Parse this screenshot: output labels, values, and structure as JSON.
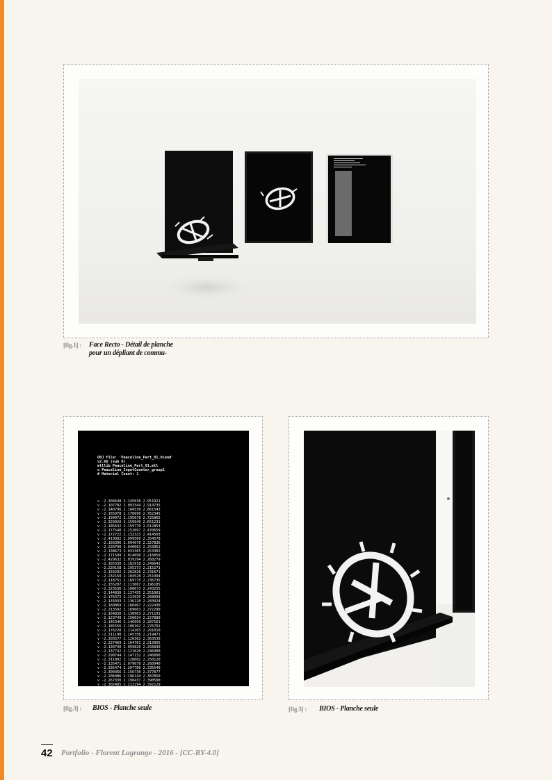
{
  "figures": [
    {
      "tag": "[fig.1] :",
      "caption_line1": "Face Recto - Détail de planche",
      "caption_line2": "pour un dépliant de commu-",
      "image_icon": "photo-display-shelf-icon"
    },
    {
      "tag": "[fig.3] :",
      "caption": "BIOS - Planche seule",
      "image_icon": "photo-obj-code-sheet-icon",
      "code_header": [
        "OBJ File: 'Peaceline_Part_01.blend'",
        "v2.66 (sub 0)",
        "mtllib Peaceline_Part_01.mtl",
        "o Peaceline_InputCounter_group1",
        "# Material Count: 1"
      ],
      "code_vertices": [
        "v -2.304648 2.145630 2.951921",
        "v -2.107782 2.093344 2.914735",
        "v -2.140796 2.184530 2.861543",
        "v -2.165978 2.170690 2.762345",
        "v -2.199972 2.195678 2.725865",
        "v -2.329920 2.159940 2.651231",
        "v -2.185632 2.159770 2.512853",
        "v -2.177540 2.152097 2.470659",
        "v -2.172722 2.132323 2.414503",
        "v -2.413002 2.099560 2.354578",
        "v -2.156396 2.094670 2.327835",
        "v -2.220790 2.040003 2.253961",
        "v -2.138673 2.033365 2.253302",
        "v -2.171599 2.014090 2.216859",
        "v -2.429632 2.039294 2.268279",
        "v -2.165330 2.182918 2.249641",
        "v -2.220158 2.195373 2.215271",
        "v -2.159292 2.202828 2.231671",
        "v -2.232169 2.104520 2.251994",
        "v -2.118751 2.169775 2.236735",
        "v -2.155207 2.113687 2.196185",
        "v -2.323536 2.106673 2.243255",
        "v -2.144830 2.137455 2.251001",
        "v -2.176372 2.123935 2.268993",
        "v -2.133333 2.136120 2.283924",
        "v -2.160069 2.160467 2.222430",
        "v -2.213592 2.169663 2.272290",
        "v -2.164830 2.130963 2.271191",
        "v -2.123749 2.150634 2.227880",
        "v -2.145346 2.146999 2.287161",
        "v -2.185556 2.106102 2.276791",
        "v -2.176220 2.114203 2.291010",
        "v -2.311190 2.145356 2.219471",
        "v -2.303577 2.120362 2.363539",
        "v -2.227469 2.104761 2.213905",
        "v -2.130740 2.059820 2.256830",
        "v -2.137742 2.121020 2.246900",
        "v -2.290744 2.147132 2.246890",
        "v -2.311802 2.128082 2.258120",
        "v -2.135471 2.079078 2.260940",
        "v -2.335474 2.207780 2.335540",
        "v -2.300366 2.156730 2.377077",
        "v -2.206086 2.196144 2.387850",
        "v -2.267330 2.198437 2.390590",
        "v -2.302485 2.212294 2.392129",
        "v -2.270475 2.213310 2.291134",
        "v -2.310926 2.222215 2.393144"
      ]
    },
    {
      "tag": "[fig.3] :",
      "caption": "BIOS - Planche seule",
      "image_icon": "photo-shelf-closeup-icon"
    }
  ],
  "footer": {
    "page_number": "42",
    "text": "Portfolio - Florent Lagrange - 2016 - [CC-BY-4.0]"
  },
  "colors": {
    "accent": "#f08a24",
    "page_background": "#f8f5ee",
    "caption_tag": "#8c8c8c",
    "footer_text": "#8f8f8f"
  }
}
